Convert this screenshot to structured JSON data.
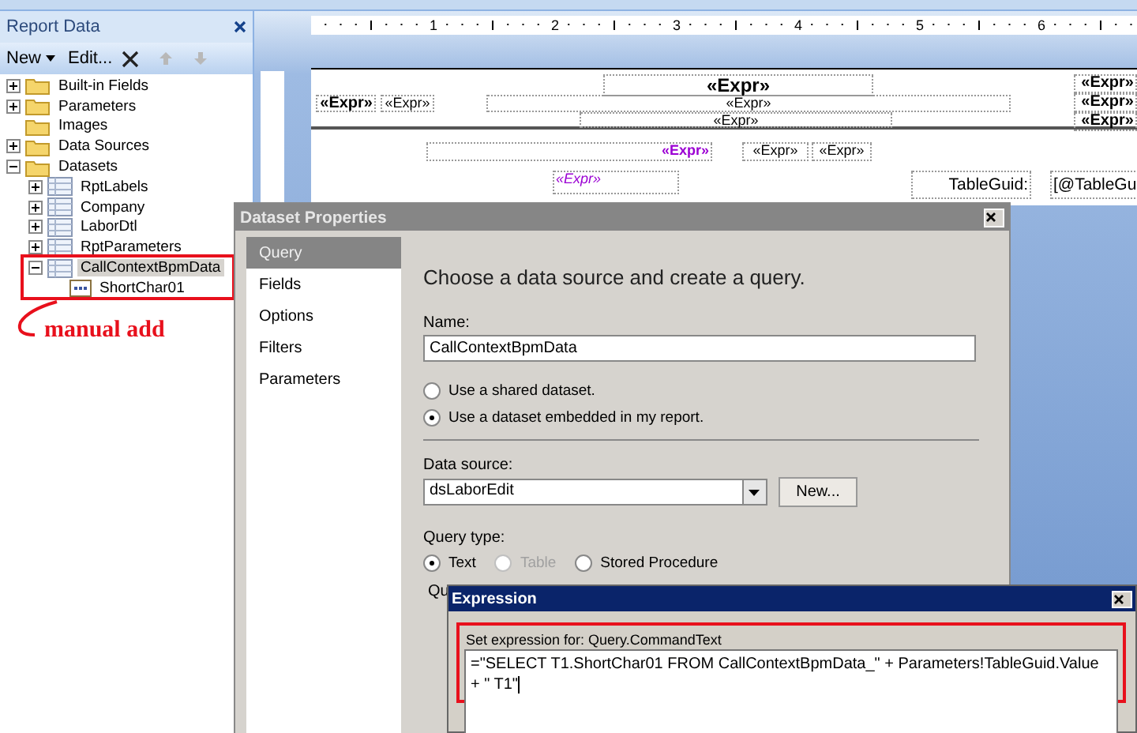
{
  "report_data": {
    "title": "Report Data",
    "toolbar": {
      "new_label": "New",
      "edit_label": "Edit..."
    },
    "tree": [
      {
        "label": "Built-in Fields",
        "kind": "folder",
        "expanded": false,
        "selected": false
      },
      {
        "label": "Parameters",
        "kind": "folder",
        "expanded": false,
        "selected": false
      },
      {
        "label": "Images",
        "kind": "folder",
        "selected": false
      },
      {
        "label": "Data Sources",
        "kind": "folder",
        "expanded": false,
        "selected": false
      },
      {
        "label": "Datasets",
        "kind": "folder",
        "expanded": true,
        "selected": false,
        "children": [
          {
            "label": "RptLabels",
            "kind": "dataset",
            "expanded": false,
            "selected": false
          },
          {
            "label": "Company",
            "kind": "dataset",
            "expanded": false,
            "selected": false
          },
          {
            "label": "LaborDtl",
            "kind": "dataset",
            "expanded": false,
            "selected": false
          },
          {
            "label": "RptParameters",
            "kind": "dataset",
            "expanded": false,
            "selected": false
          },
          {
            "label": "CallContextBpmData",
            "kind": "dataset",
            "expanded": true,
            "selected": true,
            "children": [
              {
                "label": "ShortChar01",
                "kind": "field",
                "selected": false
              }
            ]
          }
        ]
      }
    ]
  },
  "annotation": {
    "label": "manual add"
  },
  "ruler": {
    "numbers": [
      "1",
      "2",
      "3",
      "4",
      "5",
      "6"
    ]
  },
  "report_items": [
    {
      "text": "«Expr»",
      "kind": "title"
    },
    {
      "text": "«Expr»",
      "kind": "bold"
    },
    {
      "text": "«Expr»",
      "kind": "bold"
    },
    {
      "text": "«Expr»",
      "kind": "plain"
    },
    {
      "text": "«Expr»",
      "kind": "plain"
    },
    {
      "text": "«Expr»",
      "kind": "bold"
    },
    {
      "text": "«Expr»",
      "kind": "plain"
    },
    {
      "text": "«Expr»",
      "kind": "bold"
    },
    {
      "text": "«Expr»",
      "kind": "purple"
    },
    {
      "text": "«Expr»",
      "kind": "plain"
    },
    {
      "text": "«Expr»",
      "kind": "plain"
    },
    {
      "text": "«Expr»",
      "kind": "purple-italic"
    },
    {
      "text": "TableGuid:",
      "kind": "label"
    },
    {
      "text": "[@TableGu",
      "kind": "text"
    }
  ],
  "dataset_dialog": {
    "title": "Dataset Properties",
    "nav": [
      {
        "label": "Query",
        "selected": true
      },
      {
        "label": "Fields",
        "selected": false
      },
      {
        "label": "Options",
        "selected": false
      },
      {
        "label": "Filters",
        "selected": false
      },
      {
        "label": "Parameters",
        "selected": false
      }
    ],
    "heading": "Choose a data source and create a query.",
    "name_label": "Name:",
    "name_value": "CallContextBpmData",
    "dataset_options": [
      {
        "label": "Use a shared dataset.",
        "selected": false
      },
      {
        "label": "Use a dataset embedded in my report.",
        "selected": true
      }
    ],
    "data_source_label": "Data source:",
    "data_source_value": "dsLaborEdit",
    "new_button": "New...",
    "query_type_label": "Query type:",
    "query_types": [
      {
        "label": "Text",
        "selected": true,
        "disabled": false
      },
      {
        "label": "Table",
        "selected": false,
        "disabled": true
      },
      {
        "label": "Stored Procedure",
        "selected": false,
        "disabled": false
      }
    ],
    "query_label": "Qu"
  },
  "expression_dialog": {
    "title": "Expression",
    "prompt": "Set expression for: Query.CommandText",
    "expression": "=\"SELECT T1.ShortChar01 FROM CallContextBpmData_\" + Parameters!TableGuid.Value\n+ \" T1\""
  }
}
